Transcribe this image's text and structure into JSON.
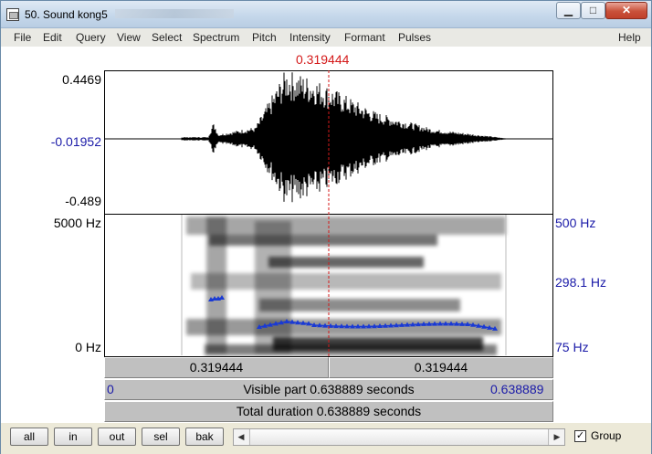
{
  "window": {
    "title": "50. Sound kong5"
  },
  "menu": [
    "File",
    "Edit",
    "Query",
    "View",
    "Select",
    "Spectrum",
    "Pitch",
    "Intensity",
    "Formant",
    "Pulses",
    "Help"
  ],
  "cursor": {
    "time_label": "0.319444"
  },
  "waveform": {
    "y_max": "0.4469",
    "y_mid": "-0.01952",
    "y_min": "-0.489"
  },
  "spectrogram": {
    "freq_max": "5000 Hz",
    "freq_min": "0 Hz",
    "pitch_max": "500 Hz",
    "pitch_current": "298.1 Hz",
    "pitch_min": "75 Hz"
  },
  "selection": {
    "left_time": "0.319444",
    "right_time": "0.319444"
  },
  "visible": {
    "start": "0",
    "text": "Visible part 0.638889 seconds",
    "end": "0.638889"
  },
  "total": {
    "text": "Total duration 0.638889 seconds"
  },
  "toolbar": {
    "all": "all",
    "in": "in",
    "out": "out",
    "sel": "sel",
    "bak": "bak",
    "group_label": "Group",
    "group_checked": "✓"
  },
  "colors": {
    "cursor": "#d41a1a",
    "pitch": "#1a3ad4",
    "axis_blue": "#1a1aa8"
  }
}
